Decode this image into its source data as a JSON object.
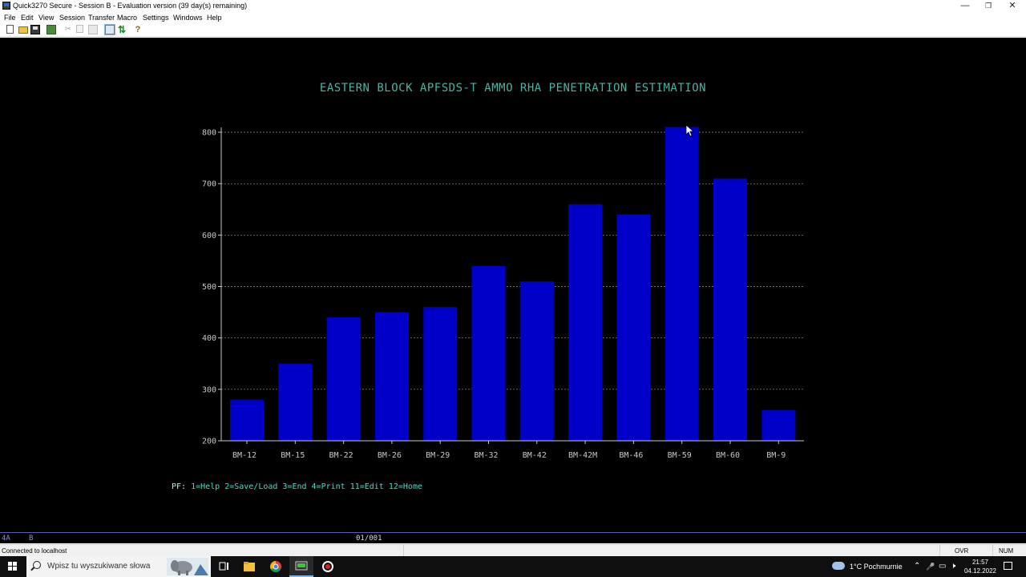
{
  "window": {
    "title": "Quick3270 Secure - Session B - Evaluation version (39 day(s) remaining)",
    "controls": {
      "minimize": "—",
      "restore": "❐",
      "close": "✕"
    }
  },
  "menu": [
    "File",
    "Edit",
    "View",
    "Session",
    "Transfer",
    "Macro",
    "Settings",
    "Windows",
    "Help"
  ],
  "toolbar": {
    "icons": [
      "new-file-icon",
      "open-folder-icon",
      "save-icon",
      "print-icon",
      "cut-icon",
      "copy-icon",
      "paste-icon",
      "mark-icon",
      "transfer-icon",
      "help-icon"
    ],
    "cut_glyph": "✂",
    "transfer_glyph": "⇅",
    "help_glyph": "?"
  },
  "terminal": {
    "title": "EASTERN BLOCK APFSDS-T AMMO RHA PENETRATION ESTIMATION",
    "pf_prefix": "PF:",
    "pf_keys": [
      "1=Help",
      "2=Save/Load",
      "3=End",
      "4=Print",
      "11=Edit",
      "12=Home"
    ]
  },
  "chart_data": {
    "type": "bar",
    "title": "EASTERN BLOCK APFSDS-T AMMO RHA PENETRATION ESTIMATION",
    "categories": [
      "BM-12",
      "BM-15",
      "BM-22",
      "BM-26",
      "BM-29",
      "BM-32",
      "BM-42",
      "BM-42M",
      "BM-46",
      "BM-59",
      "BM-60",
      "BM-9"
    ],
    "values": [
      280,
      350,
      440,
      450,
      460,
      540,
      510,
      660,
      640,
      810,
      710,
      260
    ],
    "yticks": [
      200,
      300,
      400,
      500,
      600,
      700,
      800
    ],
    "ylim": [
      200,
      800
    ],
    "grid": true,
    "colors": {
      "bar": "#0000c8",
      "axis": "#c8c8c8",
      "grid": "#9a9a9a",
      "labels": "#c8c8c8"
    }
  },
  "oia": {
    "left_a": "4A",
    "left_b": "B",
    "cursor_pos": "01/001"
  },
  "status": {
    "text": "Connected to localhost",
    "ovr": "OVR",
    "num": "NUM"
  },
  "taskbar": {
    "search_placeholder": "Wpisz tu wyszukiwane słowa",
    "weather": "1°C  Pochmurnie",
    "time": "21:57",
    "date": "04.12.2022",
    "tray": {
      "chevron": "⌃",
      "mic": "🎤",
      "net": "▭",
      "vol": "🕨"
    }
  }
}
